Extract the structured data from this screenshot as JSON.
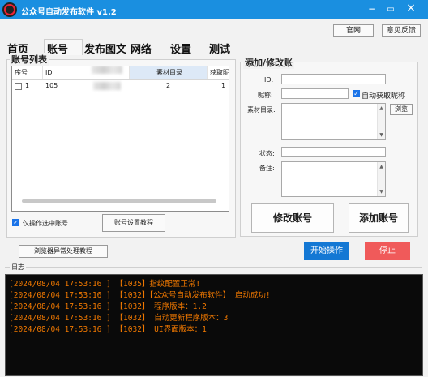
{
  "colors": {
    "titlebar": "#1a8fe0",
    "start_button": "#1478d4",
    "stop_button": "#f05a5a",
    "log_text": "#f07800"
  },
  "app": {
    "title": "公众号自动发布软件  v1.2"
  },
  "window_controls": {
    "minimize": "−",
    "maximize": "▭",
    "close": "×"
  },
  "top_buttons": {
    "website": "官网",
    "feedback": "意见反馈"
  },
  "tabs": [
    "首页",
    "账号",
    "发布图文",
    "网络",
    "设置",
    "测试"
  ],
  "account_list": {
    "title": "账号列表",
    "columns": [
      "序号",
      "ID",
      "",
      "素材目录",
      "获取昵"
    ],
    "rows": [
      {
        "index": "1",
        "id": "105",
        "material_dir": "2",
        "fetch": "1"
      }
    ],
    "only_selected_label": "仅操作选中账号",
    "setup_tutorial_button": "账号设置教程"
  },
  "form": {
    "title": "添加/修改账",
    "id_label": "ID:",
    "nickname_label": "昵称:",
    "auto_nickname_label": "自动获取昵称",
    "material_dir_label": "素材目录:",
    "browse_button": "浏览",
    "status_label": "状态:",
    "note_label": "备注:",
    "modify_button": "修改账号",
    "add_button": "添加账号"
  },
  "browser_fix_button": "浏览器异常处理教程",
  "start_button": "开始操作",
  "stop_button": "停止",
  "log": {
    "title": "日志",
    "lines": [
      "[2024/08/04 17:53:16 ]    【1035】指纹配置正常!",
      "[2024/08/04 17:53:16 ]    【1032】【公众号自动发布软件】 启动成功!",
      "[2024/08/04 17:53:16 ]    【1032】 程序版本：1.2",
      "[2024/08/04 17:53:16 ]    【1032】 自动更新程序版本：3",
      "[2024/08/04 17:53:16 ]    【1032】 UI界面版本：1"
    ]
  }
}
